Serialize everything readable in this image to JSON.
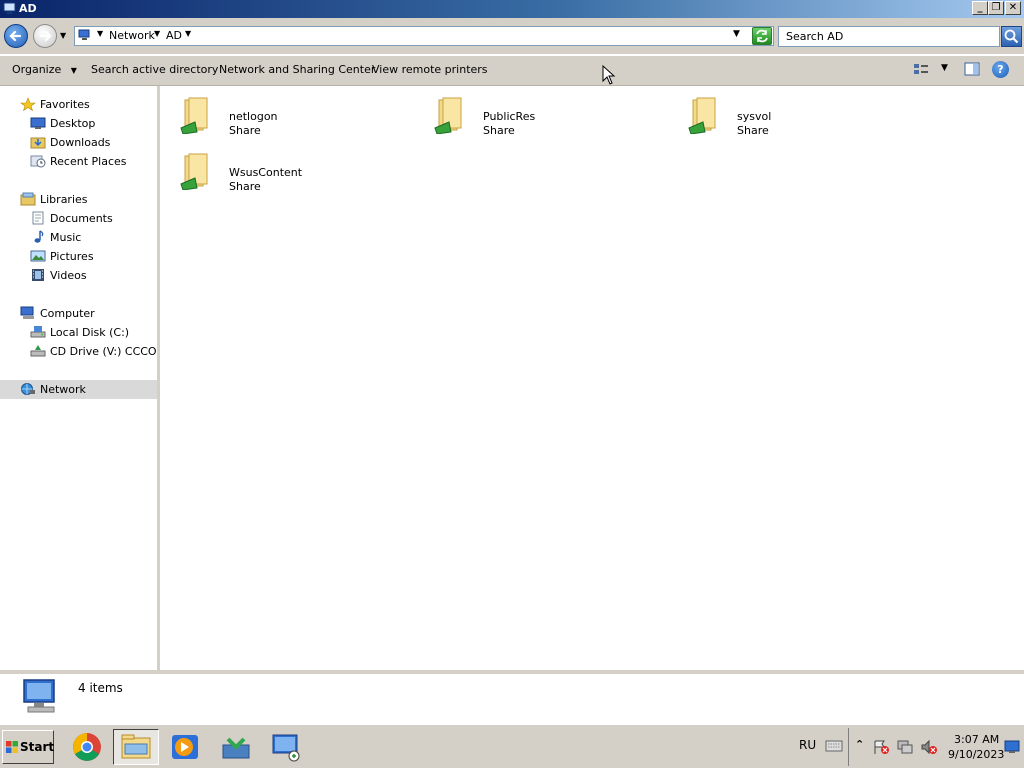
{
  "window": {
    "title": "AD"
  },
  "address": {
    "crumbs": [
      "Network",
      "AD"
    ],
    "search_placeholder": "Search AD"
  },
  "toolbar": {
    "organize": "Organize",
    "search_ad": "Search active directory",
    "network_sharing": "Network and Sharing Center",
    "remote_printers": "View remote printers"
  },
  "nav": {
    "favorites": {
      "label": "Favorites",
      "items": [
        "Desktop",
        "Downloads",
        "Recent Places"
      ]
    },
    "libraries": {
      "label": "Libraries",
      "items": [
        "Documents",
        "Music",
        "Pictures",
        "Videos"
      ]
    },
    "computer": {
      "label": "Computer",
      "items": [
        "Local Disk (C:)",
        "CD Drive (V:) CCCOMA"
      ]
    },
    "network": {
      "label": "Network"
    }
  },
  "content": {
    "items": [
      {
        "name": "netlogon",
        "type": "Share"
      },
      {
        "name": "PublicRes",
        "type": "Share"
      },
      {
        "name": "sysvol",
        "type": "Share"
      },
      {
        "name": "WsusContent",
        "type": "Share"
      }
    ]
  },
  "status": {
    "count": "4 items"
  },
  "taskbar": {
    "start": "Start",
    "language": "RU",
    "time": "3:07 AM",
    "date": "9/10/2023"
  }
}
